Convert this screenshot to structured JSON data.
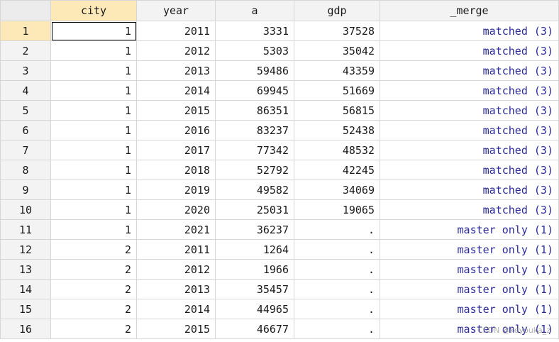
{
  "columns": [
    "city",
    "year",
    "a",
    "gdp",
    "_merge"
  ],
  "active_column": "city",
  "selected_row": 1,
  "rows": [
    {
      "n": "1",
      "city": "1",
      "year": "2011",
      "a": "3331",
      "gdp": "37528",
      "merge": "matched (3)"
    },
    {
      "n": "2",
      "city": "1",
      "year": "2012",
      "a": "5303",
      "gdp": "35042",
      "merge": "matched (3)"
    },
    {
      "n": "3",
      "city": "1",
      "year": "2013",
      "a": "59486",
      "gdp": "43359",
      "merge": "matched (3)"
    },
    {
      "n": "4",
      "city": "1",
      "year": "2014",
      "a": "69945",
      "gdp": "51669",
      "merge": "matched (3)"
    },
    {
      "n": "5",
      "city": "1",
      "year": "2015",
      "a": "86351",
      "gdp": "56815",
      "merge": "matched (3)"
    },
    {
      "n": "6",
      "city": "1",
      "year": "2016",
      "a": "83237",
      "gdp": "52438",
      "merge": "matched (3)"
    },
    {
      "n": "7",
      "city": "1",
      "year": "2017",
      "a": "77342",
      "gdp": "48532",
      "merge": "matched (3)"
    },
    {
      "n": "8",
      "city": "1",
      "year": "2018",
      "a": "52792",
      "gdp": "42245",
      "merge": "matched (3)"
    },
    {
      "n": "9",
      "city": "1",
      "year": "2019",
      "a": "49582",
      "gdp": "34069",
      "merge": "matched (3)"
    },
    {
      "n": "10",
      "city": "1",
      "year": "2020",
      "a": "25031",
      "gdp": "19065",
      "merge": "matched (3)"
    },
    {
      "n": "11",
      "city": "1",
      "year": "2021",
      "a": "36237",
      "gdp": ".",
      "merge": "master only (1)"
    },
    {
      "n": "12",
      "city": "2",
      "year": "2011",
      "a": "1264",
      "gdp": ".",
      "merge": "master only (1)"
    },
    {
      "n": "13",
      "city": "2",
      "year": "2012",
      "a": "1966",
      "gdp": ".",
      "merge": "master only (1)"
    },
    {
      "n": "14",
      "city": "2",
      "year": "2013",
      "a": "35457",
      "gdp": ".",
      "merge": "master only (1)"
    },
    {
      "n": "15",
      "city": "2",
      "year": "2014",
      "a": "44965",
      "gdp": ".",
      "merge": "master only (1)"
    },
    {
      "n": "16",
      "city": "2",
      "year": "2015",
      "a": "46677",
      "gdp": ".",
      "merge": "master only (1)"
    }
  ],
  "watermark": "CSDN @keyouka_z",
  "colors": {
    "header_bg": "#f3f3f3",
    "active_header_bg": "#fde8b8",
    "grid_line": "#d6d6d6",
    "value_label_text": "#2b2b9b"
  }
}
